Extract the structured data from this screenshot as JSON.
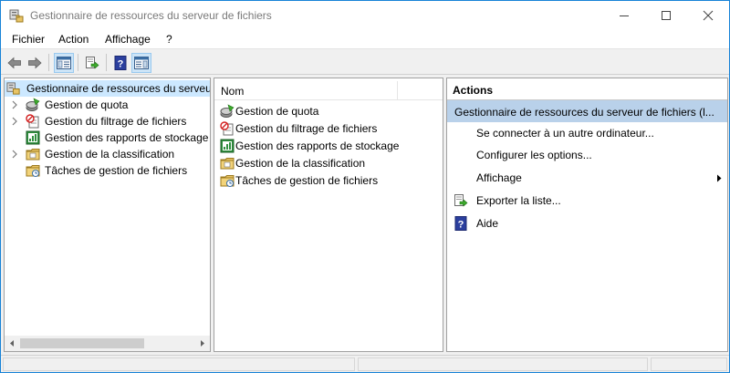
{
  "window": {
    "title": "Gestionnaire de ressources du serveur de fichiers"
  },
  "menubar": {
    "items": [
      {
        "label": "Fichier"
      },
      {
        "label": "Action"
      },
      {
        "label": "Affichage"
      },
      {
        "label": "?"
      }
    ]
  },
  "toolbar": {
    "buttons": [
      {
        "icon": "back-arrow-icon"
      },
      {
        "icon": "forward-arrow-icon"
      },
      {
        "icon": "show-hide-tree-icon"
      },
      {
        "icon": "export-list-icon"
      },
      {
        "icon": "help-icon"
      },
      {
        "icon": "show-hide-action-pane-icon"
      }
    ]
  },
  "tree": {
    "root": {
      "label": "Gestionnaire de ressources du serveur de fichiers (Local)"
    },
    "items": [
      {
        "label": "Gestion de quota",
        "icon": "quota-icon",
        "expandable": true
      },
      {
        "label": "Gestion du filtrage de fichiers",
        "icon": "file-screen-icon",
        "expandable": true
      },
      {
        "label": "Gestion des rapports de stockage",
        "icon": "storage-report-icon",
        "expandable": false
      },
      {
        "label": "Gestion de la classification",
        "icon": "classification-icon",
        "expandable": true
      },
      {
        "label": "Tâches de gestion de fichiers",
        "icon": "file-tasks-icon",
        "expandable": false
      }
    ]
  },
  "list": {
    "column_header": "Nom",
    "items": [
      {
        "label": "Gestion de quota",
        "icon": "quota-icon"
      },
      {
        "label": "Gestion du filtrage de fichiers",
        "icon": "file-screen-icon"
      },
      {
        "label": "Gestion des rapports de stockage",
        "icon": "storage-report-icon"
      },
      {
        "label": "Gestion de la classification",
        "icon": "classification-icon"
      },
      {
        "label": "Tâches de gestion de fichiers",
        "icon": "file-tasks-icon"
      }
    ]
  },
  "actions": {
    "title": "Actions",
    "group": "Gestionnaire de ressources du serveur de fichiers (l...",
    "items": [
      {
        "label": "Se connecter à un autre ordinateur...",
        "icon": ""
      },
      {
        "label": "Configurer les options...",
        "icon": ""
      },
      {
        "label": "Affichage",
        "icon": "",
        "submenu": true
      },
      {
        "label": "Exporter la liste...",
        "icon": "export-list-icon"
      },
      {
        "label": "Aide",
        "icon": "help-icon"
      }
    ]
  },
  "colors": {
    "selection": "#cce8ff",
    "group_header": "#b9d1ea",
    "window_border": "#1883d7"
  }
}
